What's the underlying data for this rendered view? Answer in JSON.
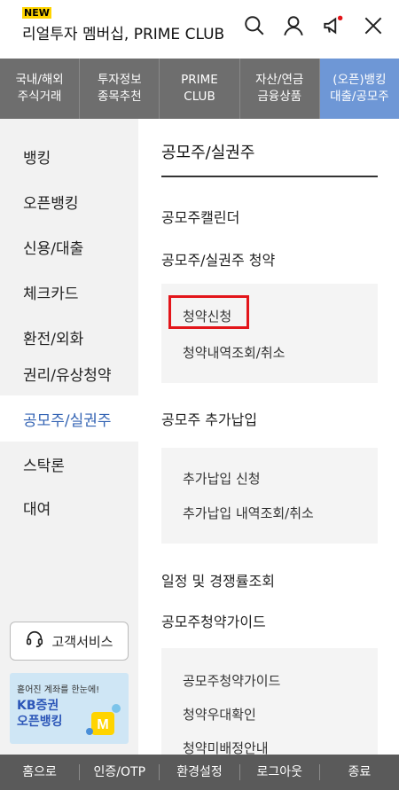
{
  "header": {
    "new_badge": "NEW",
    "title": "리얼투자 멤버십, PRIME CLUB",
    "icons": [
      "search-icon",
      "user-icon",
      "megaphone-icon",
      "close-icon"
    ],
    "notification_dot_color": "#e3151a"
  },
  "topnav": {
    "tabs": [
      {
        "label": "국내/해외\n주식거래"
      },
      {
        "label": "투자정보\n종목추천"
      },
      {
        "label": "PRIME\nCLUB"
      },
      {
        "label": "자산/연금\n금융상품"
      },
      {
        "label": "(오픈)뱅킹\n대출/공모주",
        "active": true
      }
    ],
    "bg_color": "#6e6e6e",
    "active_color": "#6e97d6"
  },
  "sidebar": {
    "items": [
      {
        "label": "뱅킹"
      },
      {
        "label": "오픈뱅킹"
      },
      {
        "label": "신용/대출"
      },
      {
        "label": "체크카드"
      },
      {
        "label": "환전/외화"
      },
      {
        "label": "권리/유상청약"
      },
      {
        "label": "공모주/실권주",
        "active": true
      },
      {
        "label": "스탁론"
      },
      {
        "label": "대여"
      }
    ],
    "active_color": "#3464b4",
    "customer_service": "고객서비스",
    "banner": {
      "line1": "흩어진 계좌를 한눈에!",
      "line2": "KB증권\n오픈뱅킹"
    }
  },
  "content": {
    "heading": "공모주/실권주",
    "menus": [
      {
        "label": "공모주캘린더"
      },
      {
        "label": "공모주/실권주 청약",
        "subs": [
          "청약신청",
          "청약내역조회/취소"
        ]
      },
      {
        "label": "공모주 추가납입",
        "subs": [
          "추가납입 신청",
          "추가납입 내역조회/취소"
        ]
      },
      {
        "label": "일정 및 경쟁률조회"
      },
      {
        "label": "공모주청약가이드",
        "subs": [
          "공모주청약가이드",
          "청약우대확인",
          "청약미배정안내"
        ]
      }
    ],
    "highlight_color": "#e3151a"
  },
  "bottombar": {
    "items": [
      "홈으로",
      "인증/OTP",
      "환경설정",
      "로그아웃",
      "종료"
    ]
  }
}
